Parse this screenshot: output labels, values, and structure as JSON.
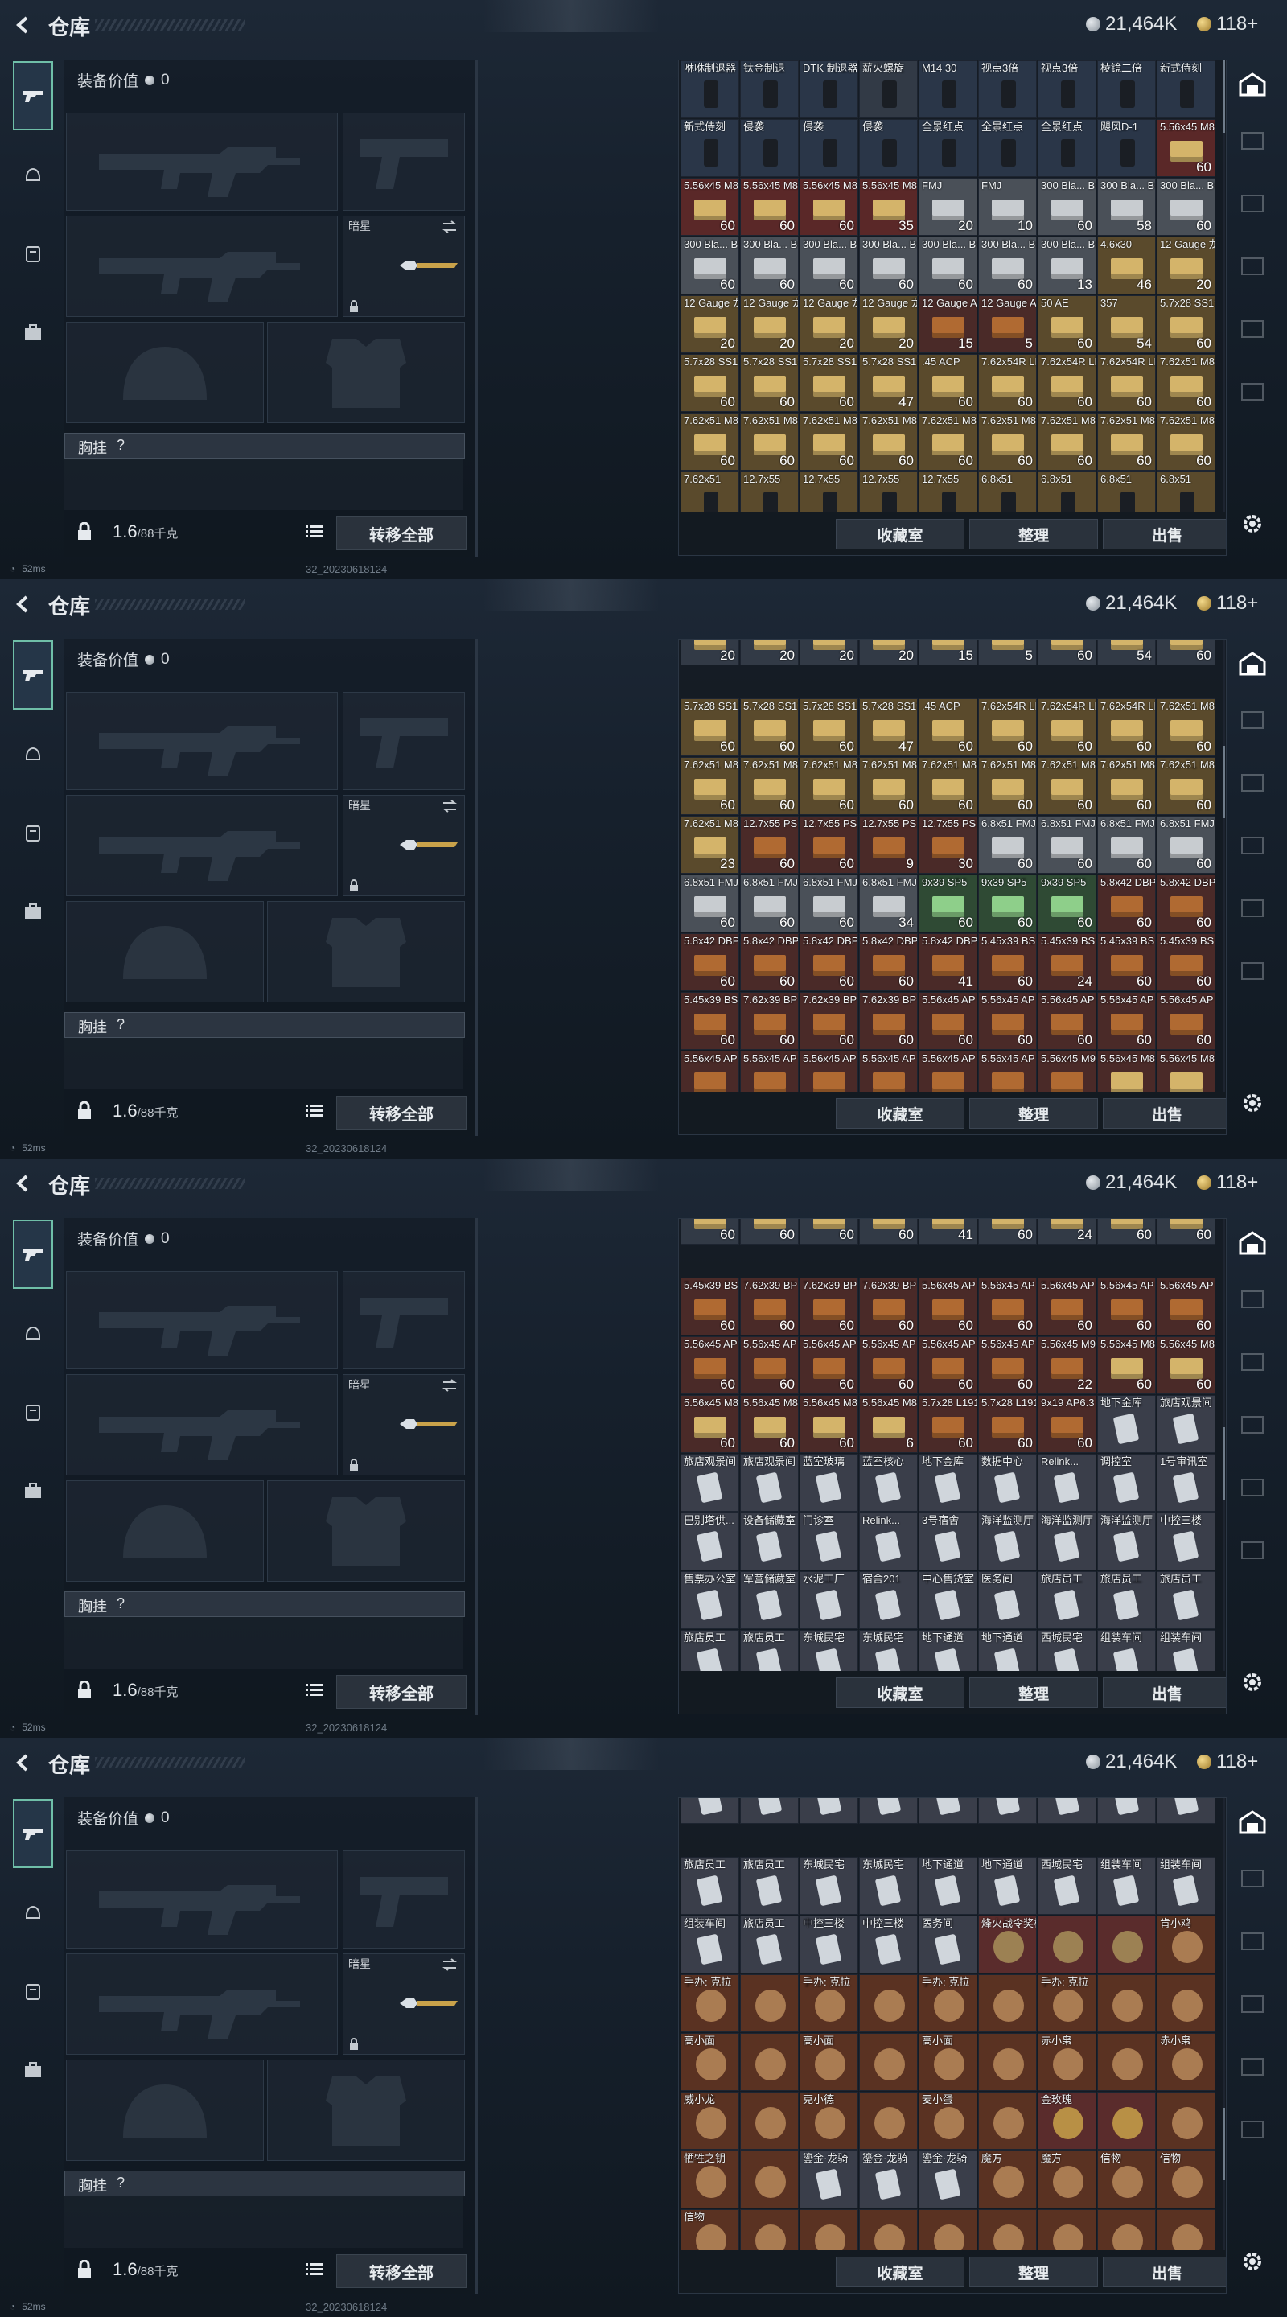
{
  "header": {
    "title": "仓库",
    "silver": "21,464K",
    "gold": "118+"
  },
  "left": {
    "equip_value_label": "装备价值",
    "equip_value": "0",
    "slot_secondary_label": "暗星",
    "chest_label": "胸挂",
    "chest_hint": "?",
    "weight": "1.6",
    "weight_max": "/88千克",
    "transfer_all": "转移全部"
  },
  "warehouse": {
    "buttons": [
      "收藏室",
      "整理",
      "出售"
    ]
  },
  "status": {
    "ping": "52ms",
    "build": "32_20230618124"
  },
  "colors": {
    "accent": "#6fbfa8",
    "ammo_gold": "#9a7a3a",
    "ammo_red": "#7c3030"
  },
  "frames": [
    {
      "scroll": 0.0,
      "rows": [
        [
          [
            "咻咻制退器",
            ""
          ],
          [
            "钛金制退",
            ""
          ],
          [
            "DTK 制退器",
            ""
          ],
          [
            "薪火螺旋",
            ""
          ],
          [
            "M14 30",
            ""
          ],
          [
            "视点3倍",
            ""
          ],
          [
            "视点3倍",
            ""
          ],
          [
            "棱镜二倍",
            ""
          ],
          [
            "新式侍刻",
            ""
          ]
        ],
        [
          [
            "新式侍刻",
            ""
          ],
          [
            "侵袭",
            ""
          ],
          [
            "侵袭",
            ""
          ],
          [
            "侵袭",
            ""
          ],
          [
            "全景红点",
            ""
          ],
          [
            "全景红点",
            ""
          ],
          [
            "全景红点",
            ""
          ],
          [
            "飓风D-1",
            ""
          ],
          [
            "5.56x45 M855",
            "60"
          ]
        ],
        [
          [
            "5.56x45 M855",
            "60"
          ],
          [
            "5.56x45 M855",
            "60"
          ],
          [
            "5.56x45 M855",
            "60"
          ],
          [
            "5.56x45 M855",
            "35"
          ],
          [
            "FMJ",
            "20"
          ],
          [
            "FMJ",
            "10"
          ],
          [
            "300 Bla... BCP FMJ",
            "60"
          ],
          [
            "300 Bla... BCP FMJ",
            "58"
          ],
          [
            "300 Bla... BCP FMJ",
            "60"
          ]
        ],
        [
          [
            "300 Bla... BCP FMJ",
            "60"
          ],
          [
            "300 Bla... BCP FMJ",
            "60"
          ],
          [
            "300 Bla... BCP FMJ",
            "60"
          ],
          [
            "300 Bla... BCP FMJ",
            "60"
          ],
          [
            "300 Bla... BCP FMJ",
            "60"
          ],
          [
            "300 Bla... BCP FMJ",
            "60"
          ],
          [
            "300 Bla... BCP FMJ",
            "13"
          ],
          [
            "4.6x30",
            "46"
          ],
          [
            "12 Gauge 龙息",
            "20"
          ]
        ],
        [
          [
            "12 Gauge 龙息",
            "20"
          ],
          [
            "12 Gauge 龙息",
            "20"
          ],
          [
            "12 Gauge 龙息",
            "20"
          ],
          [
            "12 Gauge 龙息",
            "20"
          ],
          [
            "12 Gauge AP-20",
            "15"
          ],
          [
            "12 Gauge AP-20",
            "5"
          ],
          [
            "50 AE",
            "60"
          ],
          [
            "357",
            "54"
          ],
          [
            "5.7x28 SS190",
            "60"
          ]
        ],
        [
          [
            "5.7x28 SS190",
            "60"
          ],
          [
            "5.7x28 SS190",
            "60"
          ],
          [
            "5.7x28 SS190",
            "60"
          ],
          [
            "5.7x28 SS190",
            "47"
          ],
          [
            ".45 ACP",
            "60"
          ],
          [
            "7.62x54R LPS",
            "60"
          ],
          [
            "7.62x54R LPS",
            "60"
          ],
          [
            "7.62x54R LPS",
            "60"
          ],
          [
            "7.62x51 M80",
            "60"
          ]
        ],
        [
          [
            "7.62x51 M80",
            "60"
          ],
          [
            "7.62x51 M80",
            "60"
          ],
          [
            "7.62x51 M80",
            "60"
          ],
          [
            "7.62x51 M80",
            "60"
          ],
          [
            "7.62x51 M80",
            "60"
          ],
          [
            "7.62x51 M80",
            "60"
          ],
          [
            "7.62x51 M80",
            "60"
          ],
          [
            "7.62x51 M80",
            "60"
          ],
          [
            "7.62x51 M80",
            "60"
          ]
        ],
        [
          [
            "7.62x51",
            ""
          ],
          [
            "12.7x55",
            ""
          ],
          [
            "12.7x55",
            ""
          ],
          [
            "12.7x55",
            ""
          ],
          [
            "12.7x55",
            ""
          ],
          [
            "6.8x51",
            ""
          ],
          [
            "6.8x51",
            ""
          ],
          [
            "6.8x51",
            ""
          ],
          [
            "6.8x51",
            ""
          ]
        ]
      ]
    },
    {
      "scroll": 0.28,
      "rows": [
        [
          [
            "",
            "20"
          ],
          [
            "",
            "20"
          ],
          [
            "",
            "20"
          ],
          [
            "",
            "20"
          ],
          [
            "",
            "15"
          ],
          [
            "",
            "5"
          ],
          [
            "",
            "60"
          ],
          [
            "",
            "54"
          ],
          [
            "",
            "60"
          ]
        ],
        [
          [
            "5.7x28 SS190",
            "60"
          ],
          [
            "5.7x28 SS190",
            "60"
          ],
          [
            "5.7x28 SS190",
            "60"
          ],
          [
            "5.7x28 SS190",
            "47"
          ],
          [
            ".45 ACP",
            "60"
          ],
          [
            "7.62x54R LPS",
            "60"
          ],
          [
            "7.62x54R LPS",
            "60"
          ],
          [
            "7.62x54R LPS",
            "60"
          ],
          [
            "7.62x51 M80",
            "60"
          ]
        ],
        [
          [
            "7.62x51 M80",
            "60"
          ],
          [
            "7.62x51 M80",
            "60"
          ],
          [
            "7.62x51 M80",
            "60"
          ],
          [
            "7.62x51 M80",
            "60"
          ],
          [
            "7.62x51 M80",
            "60"
          ],
          [
            "7.62x51 M80",
            "60"
          ],
          [
            "7.62x51 M80",
            "60"
          ],
          [
            "7.62x51 M80",
            "60"
          ],
          [
            "7.62x51 M80",
            "60"
          ]
        ],
        [
          [
            "7.62x51 M80",
            "23"
          ],
          [
            "12.7x55 PS12A",
            "60"
          ],
          [
            "12.7x55 PS12A",
            "60"
          ],
          [
            "12.7x55 PS12A",
            "9"
          ],
          [
            "12.7x55 PS12B",
            "30"
          ],
          [
            "6.8x51 FMJ",
            "60"
          ],
          [
            "6.8x51 FMJ",
            "60"
          ],
          [
            "6.8x51 FMJ",
            "60"
          ],
          [
            "6.8x51 FMJ",
            "60"
          ]
        ],
        [
          [
            "6.8x51 FMJ",
            "60"
          ],
          [
            "6.8x51 FMJ",
            "60"
          ],
          [
            "6.8x51 FMJ",
            "60"
          ],
          [
            "6.8x51 FMJ",
            "34"
          ],
          [
            "9x39 SP5",
            "60"
          ],
          [
            "9x39 SP5",
            "60"
          ],
          [
            "9x39 SP5",
            "60"
          ],
          [
            "5.8x42 DBP10",
            "60"
          ],
          [
            "5.8x42 DBP10",
            "60"
          ]
        ],
        [
          [
            "5.8x42 DBP10",
            "60"
          ],
          [
            "5.8x42 DBP10",
            "60"
          ],
          [
            "5.8x42 DBP10",
            "60"
          ],
          [
            "5.8x42 DBP10",
            "60"
          ],
          [
            "5.8x42 DBP10",
            "41"
          ],
          [
            "5.45x39 BS",
            "60"
          ],
          [
            "5.45x39 BS",
            "24"
          ],
          [
            "5.45x39 BS",
            "60"
          ],
          [
            "5.45x39 BS",
            "60"
          ]
        ],
        [
          [
            "5.45x39 BS",
            "60"
          ],
          [
            "7.62x39 BP",
            "60"
          ],
          [
            "7.62x39 BP",
            "60"
          ],
          [
            "7.62x39 BP",
            "60"
          ],
          [
            "5.56x45 AP",
            "60"
          ],
          [
            "5.56x45 AP",
            "60"
          ],
          [
            "5.56x45 AP",
            "60"
          ],
          [
            "5.56x45 AP",
            "60"
          ],
          [
            "5.56x45 AP",
            "60"
          ]
        ],
        [
          [
            "5.56x45 AP",
            "60"
          ],
          [
            "5.56x45 AP",
            "60"
          ],
          [
            "5.56x45 AP",
            "60"
          ],
          [
            "5.56x45 AP",
            "60"
          ],
          [
            "5.56x45 AP",
            "60"
          ],
          [
            "5.56x45 AP",
            "60"
          ],
          [
            "5.56x45 M995",
            "22"
          ],
          [
            "5.56x45 M855A1",
            "60"
          ],
          [
            "5.56x45 M855A1",
            "60"
          ]
        ]
      ]
    },
    {
      "scroll": 0.55,
      "rows": [
        [
          [
            "",
            "60"
          ],
          [
            "",
            "60"
          ],
          [
            "",
            "60"
          ],
          [
            "",
            "60"
          ],
          [
            "",
            "41"
          ],
          [
            "",
            "60"
          ],
          [
            "",
            "24"
          ],
          [
            "",
            "60"
          ],
          [
            "",
            "60"
          ]
        ],
        [
          [
            "5.45x39 BS",
            "60"
          ],
          [
            "7.62x39 BP",
            "60"
          ],
          [
            "7.62x39 BP",
            "60"
          ],
          [
            "7.62x39 BP",
            "60"
          ],
          [
            "5.56x45 AP",
            "60"
          ],
          [
            "5.56x45 AP",
            "60"
          ],
          [
            "5.56x45 AP",
            "60"
          ],
          [
            "5.56x45 AP",
            "60"
          ],
          [
            "5.56x45 AP",
            "60"
          ]
        ],
        [
          [
            "5.56x45 AP",
            "60"
          ],
          [
            "5.56x45 AP",
            "60"
          ],
          [
            "5.56x45 AP",
            "60"
          ],
          [
            "5.56x45 AP",
            "60"
          ],
          [
            "5.56x45 AP",
            "60"
          ],
          [
            "5.56x45 AP",
            "60"
          ],
          [
            "5.56x45 M995",
            "22"
          ],
          [
            "5.56x45 M855A1",
            "60"
          ],
          [
            "5.56x45 M855A1",
            "60"
          ]
        ],
        [
          [
            "5.56x45 M855A1",
            "60"
          ],
          [
            "5.56x45 M855A1",
            "60"
          ],
          [
            "5.56x45 M855A1",
            "60"
          ],
          [
            "5.56x45 M855A1",
            "6"
          ],
          [
            "5.7x28 L191",
            "60"
          ],
          [
            "5.7x28 L191",
            "60"
          ],
          [
            "9x19 AP6.3",
            "60"
          ],
          [
            "地下金库",
            "K"
          ],
          [
            "旅店观景间",
            "K"
          ]
        ],
        [
          [
            "旅店观景间",
            "K"
          ],
          [
            "旅店观景间",
            "K"
          ],
          [
            "蓝室玻璃",
            "K"
          ],
          [
            "蓝室核心",
            "K"
          ],
          [
            "地下金库",
            "K"
          ],
          [
            "数据中心",
            "K"
          ],
          [
            "Relink...",
            "K"
          ],
          [
            "调控室",
            "K"
          ],
          [
            "1号审讯室",
            "K"
          ]
        ],
        [
          [
            "巴别塔供...",
            "K"
          ],
          [
            "设备储藏室",
            "K"
          ],
          [
            "门诊室",
            "K"
          ],
          [
            "Relink...",
            "K"
          ],
          [
            "3号宿舍",
            "K"
          ],
          [
            "海洋监测厅",
            "K"
          ],
          [
            "海洋监测厅",
            "K"
          ],
          [
            "海洋监测厅",
            "K"
          ],
          [
            "中控三楼",
            "K"
          ]
        ],
        [
          [
            "售票办公室",
            "K"
          ],
          [
            "军营储藏室",
            "K"
          ],
          [
            "水泥工厂",
            "K"
          ],
          [
            "宿舍201",
            "K"
          ],
          [
            "中心售货室",
            "K"
          ],
          [
            "医务间",
            "K"
          ],
          [
            "旅店员工",
            "K"
          ],
          [
            "旅店员工",
            "K"
          ],
          [
            "旅店员工",
            "K"
          ]
        ],
        [
          [
            "旅店员工",
            "K"
          ],
          [
            "旅店员工",
            "K"
          ],
          [
            "东城民宅",
            "K"
          ],
          [
            "东城民宅",
            "K"
          ],
          [
            "地下通道",
            "K"
          ],
          [
            "地下通道",
            "K"
          ],
          [
            "西城民宅",
            "K"
          ],
          [
            "组装车间",
            "K"
          ],
          [
            "组装车间",
            "K"
          ]
        ]
      ]
    },
    {
      "scroll": 0.82,
      "rows": [
        [
          [
            "售票办公室",
            "K"
          ],
          [
            "军营储藏室",
            "K"
          ],
          [
            "水泥工厂",
            "K"
          ],
          [
            "宿舍201",
            "K"
          ],
          [
            "中心售货室",
            "K"
          ],
          [
            "医务间",
            "K"
          ],
          [
            "旅店员工",
            "K"
          ],
          [
            "旅店员工",
            "K"
          ],
          [
            "旅店员工",
            "K"
          ]
        ],
        [
          [
            "旅店员工",
            "K"
          ],
          [
            "旅店员工",
            "K"
          ],
          [
            "东城民宅",
            "K"
          ],
          [
            "东城民宅",
            "K"
          ],
          [
            "地下通道",
            "K"
          ],
          [
            "地下通道",
            "K"
          ],
          [
            "西城民宅",
            "K"
          ],
          [
            "组装车间",
            "K"
          ],
          [
            "组装车间",
            "K"
          ]
        ],
        [
          [
            "组装车间",
            "K"
          ],
          [
            "旅店员工",
            "K"
          ],
          [
            "中控三楼",
            "K"
          ],
          [
            "中控三楼",
            "K"
          ],
          [
            "医务间",
            "K"
          ],
          [
            "烽火战令奖杯",
            "T"
          ],
          [
            "",
            "T"
          ],
          [
            "",
            "T"
          ],
          [
            "肯小鸡",
            "F"
          ]
        ],
        [
          [
            "手办: 克拉",
            "F"
          ],
          [
            "",
            "F"
          ],
          [
            "手办: 克拉",
            "F"
          ],
          [
            "",
            "F"
          ],
          [
            "手办: 克拉",
            "F"
          ],
          [
            "",
            "F"
          ],
          [
            "手办: 克拉",
            "F"
          ],
          [
            "",
            "F"
          ],
          [
            "",
            "F"
          ]
        ],
        [
          [
            "高小面",
            "F"
          ],
          [
            "",
            "F"
          ],
          [
            "高小面",
            "F"
          ],
          [
            "",
            "F"
          ],
          [
            "高小面",
            "F"
          ],
          [
            "",
            "F"
          ],
          [
            "赤小枭",
            "F"
          ],
          [
            "",
            "F"
          ],
          [
            "赤小枭",
            "F"
          ]
        ],
        [
          [
            "威小龙",
            "F"
          ],
          [
            "",
            "F"
          ],
          [
            "克小德",
            "F"
          ],
          [
            "",
            "F"
          ],
          [
            "麦小蛋",
            "F"
          ],
          [
            "",
            "F"
          ],
          [
            "金玫瑰",
            "G"
          ],
          [
            "",
            "G"
          ],
          [
            "",
            "F"
          ]
        ],
        [
          [
            "牺牲之钥",
            "F"
          ],
          [
            "",
            "F"
          ],
          [
            "鎏金·龙骑",
            "K"
          ],
          [
            "鎏金·龙骑",
            "K"
          ],
          [
            "鎏金·龙骑",
            "K"
          ],
          [
            "魔方",
            "F"
          ],
          [
            "魔方",
            "F"
          ],
          [
            "信物",
            "F"
          ],
          [
            "信物",
            "F"
          ]
        ],
        [
          [
            "信物",
            "F"
          ],
          [
            "",
            "F"
          ],
          [
            "",
            "F"
          ],
          [
            "",
            "F"
          ],
          [
            "",
            "F"
          ],
          [
            "",
            "F"
          ],
          [
            "",
            "F"
          ],
          [
            "",
            "F"
          ],
          [
            "",
            "F"
          ]
        ]
      ]
    }
  ]
}
